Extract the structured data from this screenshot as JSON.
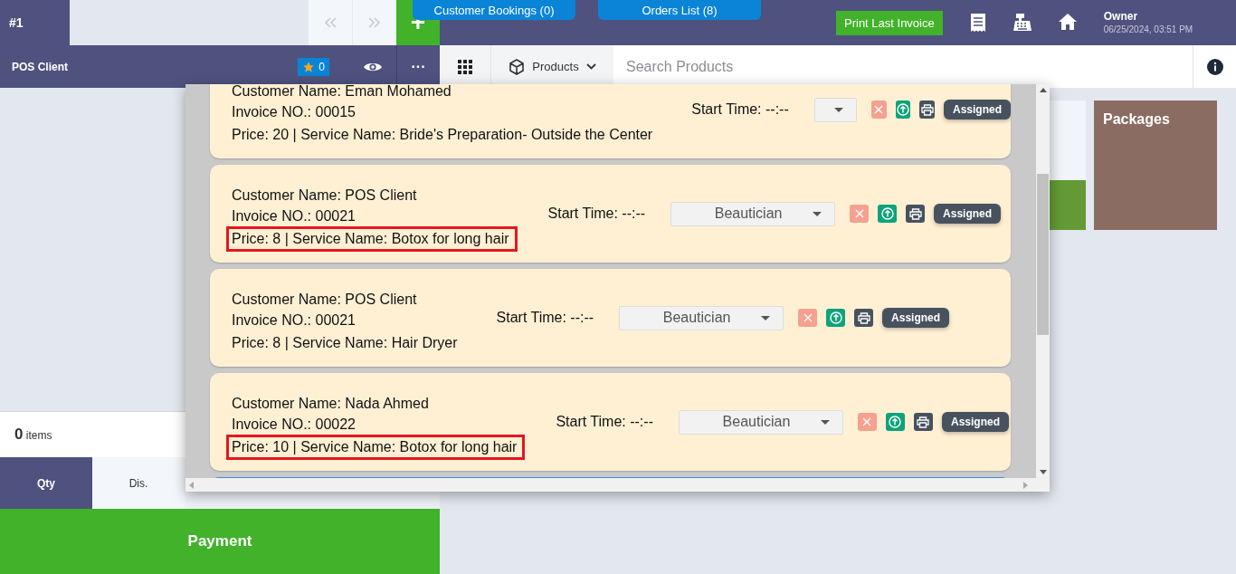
{
  "header": {
    "tab_number": "#1",
    "new_button": "+",
    "bookings_tab": "Customer Bookings (0)",
    "orders_tab": "Orders List (8)",
    "print_button": "Print Last Invoice",
    "user": "Owner",
    "datetime": "06/25/2024, 03:51 PM"
  },
  "client_bar": {
    "client": "POS Client",
    "favorites": "0",
    "more": "···"
  },
  "product_bar": {
    "category": "Products",
    "search_placeholder": "Search Products"
  },
  "cart": {
    "count": "0",
    "unit": "items",
    "columns": [
      {
        "label": "Qty",
        "selected": true
      },
      {
        "label": "Dis.",
        "selected": false
      }
    ],
    "payment": "Payment"
  },
  "tiles": [
    {
      "label": "Packages",
      "color": "#8b6c62"
    }
  ],
  "bookings": [
    {
      "customer": "Customer Name: Eman Mohamed",
      "invoice": "Invoice NO.: 00015",
      "price_service": "Price: 20 | Service Name: Bride's Preparation- Outside the Center",
      "start_time": "Start Time: --:--",
      "status": "Assigned",
      "highlighted": false
    },
    {
      "customer": "Customer Name: POS Client",
      "invoice": "Invoice NO.: 00021",
      "price_service": "Price: 8 | Service Name: Botox for long hair",
      "start_time": "Start Time: --:--",
      "staff": "Beautician",
      "status": "Assigned",
      "highlighted": true
    },
    {
      "customer": "Customer Name: POS Client",
      "invoice": "Invoice NO.: 00021",
      "price_service": "Price: 8 | Service Name: Hair Dryer",
      "start_time": "Start Time: --:--",
      "staff": "Beautician",
      "status": "Assigned",
      "highlighted": false
    },
    {
      "customer": "Customer Name: Nada Ahmed",
      "invoice": "Invoice NO.: 00022",
      "price_service": "Price: 10 | Service Name: Botox for long hair",
      "start_time": "Start Time: --:--",
      "staff": "Beautician",
      "status": "Assigned",
      "highlighted": true
    }
  ]
}
